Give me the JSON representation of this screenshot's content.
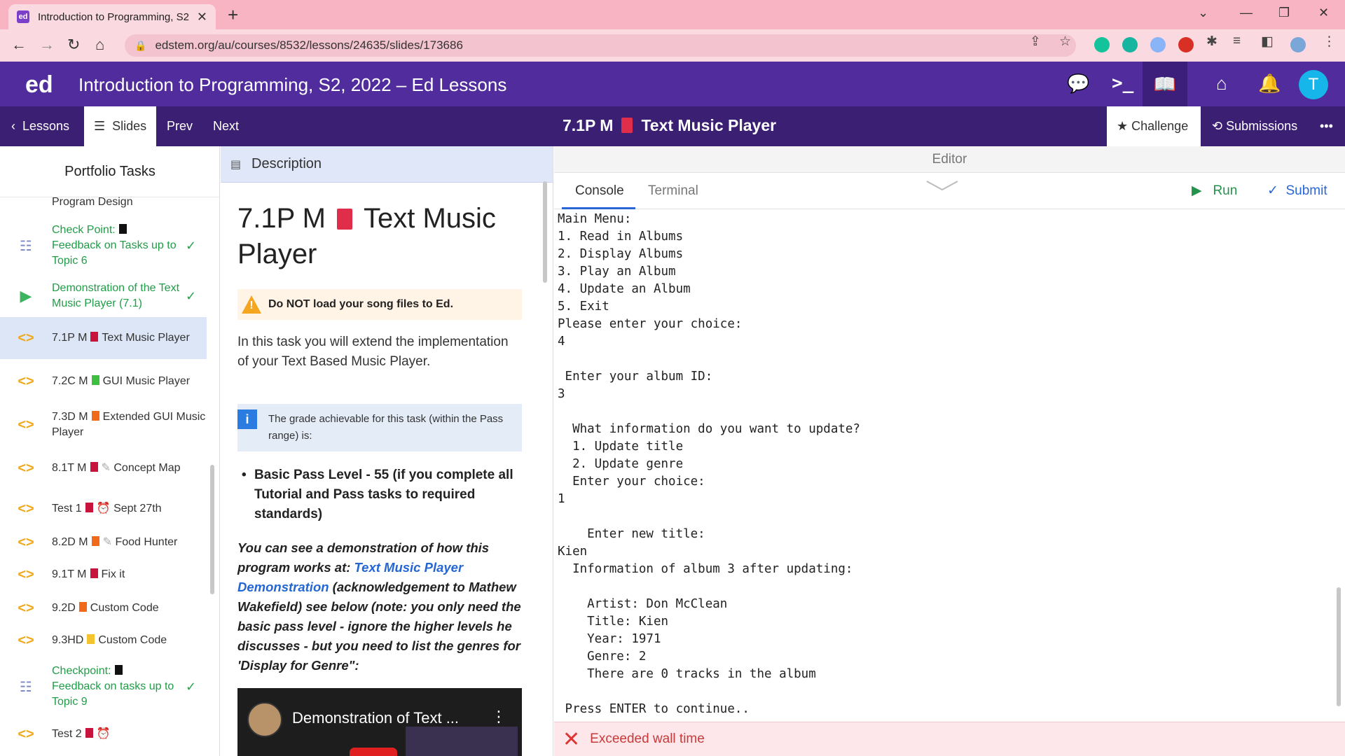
{
  "browser": {
    "tab_title": "Introduction to Programming, S2",
    "favicon_text": "ed",
    "url": "edstem.org/au/courses/8532/lessons/24635/slides/173686"
  },
  "header": {
    "logo": "ed",
    "course_title": "Introduction to Programming, S2, 2022 – Ed Lessons",
    "avatar_letter": "T"
  },
  "lessonbar": {
    "lessons": "Lessons",
    "slides": "Slides",
    "prev": "Prev",
    "next": "Next",
    "slide_code": "7.1P M",
    "slide_name": "Text Music Player",
    "challenge": "Challenge",
    "submissions": "Submissions",
    "more": "•••"
  },
  "sidebar": {
    "title": "Portfolio Tasks",
    "items": [
      {
        "label": "Program Design",
        "icon": "code-icon"
      },
      {
        "label": "Check Point:",
        "label2": "Feedback on Tasks up to Topic 6",
        "icon": "list-icon",
        "done": true
      },
      {
        "label": "Demonstration of the Text Music Player (7.1)",
        "icon": "play-icon",
        "done": true
      },
      {
        "label": "7.1P M",
        "label2": "Text Music Player",
        "color": "#c8143c",
        "icon": "code-icon"
      },
      {
        "label": "7.2C M",
        "label2": "GUI Music Player",
        "color": "#3fbf3f",
        "icon": "code-icon"
      },
      {
        "label": "7.3D M",
        "label2": "Extended GUI Music Player",
        "color": "#f06a1a",
        "icon": "code-icon"
      },
      {
        "label": "8.1T M",
        "label2": "Concept Map",
        "color": "#c8143c",
        "icon": "code-icon"
      },
      {
        "label": "Test 1",
        "label2": "Sept 27th",
        "color": "#c8143c",
        "icon": "code-icon"
      },
      {
        "label": "8.2D M",
        "label2": "Food Hunter",
        "color": "#f06a1a",
        "icon": "code-icon"
      },
      {
        "label": "9.1T M",
        "label2": "Fix it",
        "color": "#c8143c",
        "icon": "code-icon"
      },
      {
        "label": "9.2D",
        "label2": "Custom Code",
        "color": "#f06a1a",
        "icon": "code-icon"
      },
      {
        "label": "9.3HD",
        "label2": "Custom Code",
        "color": "#f4c430",
        "icon": "code-icon"
      },
      {
        "label": "Checkpoint:",
        "label2": "Feedback on tasks up to Topic 9",
        "icon": "list-icon",
        "done": true
      },
      {
        "label": "Test 2",
        "color": "#c8143c",
        "icon": "code-icon"
      }
    ]
  },
  "description": {
    "header": "Description",
    "title_code": "7.1P M",
    "title_name": "Text Music Player",
    "warning": "Do NOT load your song files to Ed.",
    "intro": "In this task you will extend the implementation of your Text Based Music Player.",
    "info": "The grade achievable for this task (within the Pass range) is:",
    "bullet": "Basic Pass Level - 55 (if you complete all Tutorial and Pass tasks to required standards)",
    "demo_pre": "You can see a demonstration of how this program works at: ",
    "demo_link": "Text Music Player Demonstration",
    "demo_post": " (acknowledgement to Mathew Wakefield) see below (note: you only need the basic pass level - ignore the higher levels he discusses - but you need to list the genres for 'Display for Genre\":",
    "video_title": "Demonstration of Text ..."
  },
  "editor": {
    "header": "Editor",
    "tab_console": "Console",
    "tab_terminal": "Terminal",
    "run": "Run",
    "submit": "Submit",
    "console_output": "Main Menu:\n1. Read in Albums\n2. Display Albums\n3. Play an Album\n4. Update an Album\n5. Exit\nPlease enter your choice:\n4\n\n Enter your album ID:\n3\n\n  What information do you want to update?\n  1. Update title\n  2. Update genre\n  Enter your choice:\n1\n\n    Enter new title:\nKien\n  Information of album 3 after updating:\n\n    Artist: Don McClean\n    Title: Kien\n    Year: 1971\n    Genre: 2\n    There are 0 tracks in the album\n\n Press ENTER to continue..",
    "error": "Exceeded wall time"
  },
  "colors": {
    "header_purple": "#512c9d",
    "lessonbar_purple": "#3b1f73",
    "run_green": "#23924a",
    "submit_blue": "#2a66d6",
    "error_red": "#c83a3a"
  }
}
